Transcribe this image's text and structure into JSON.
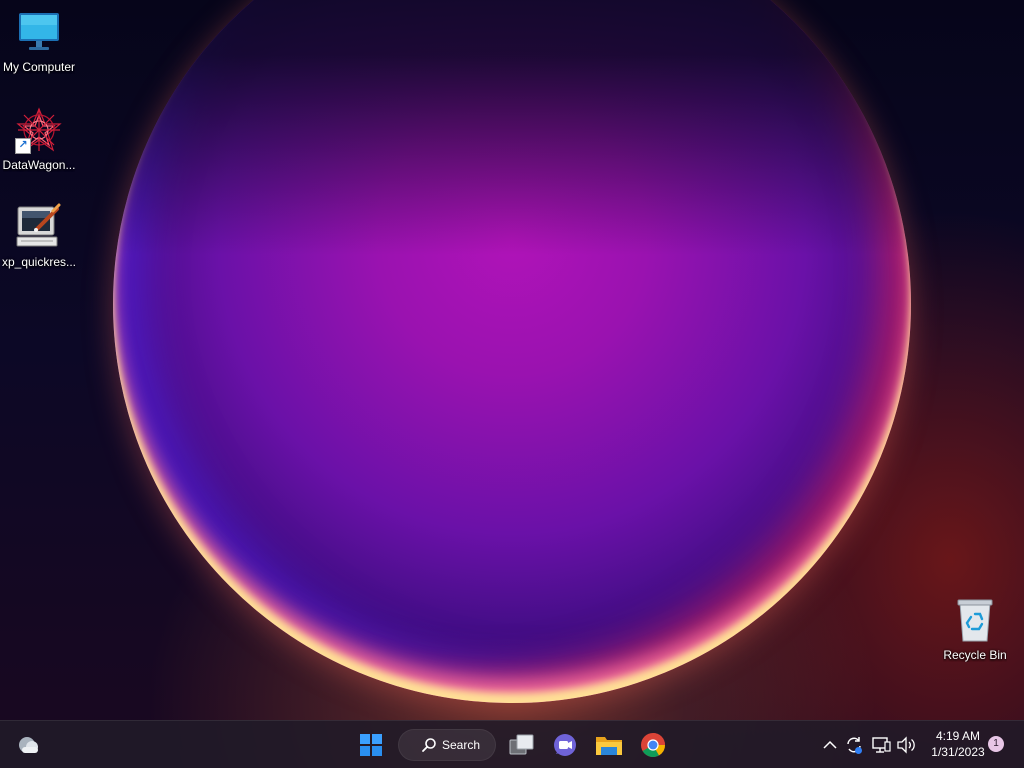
{
  "desktop": {
    "icons": [
      {
        "label": "My Computer",
        "icon": "monitor-icon"
      },
      {
        "label": "DataWagon...",
        "icon": "datawagon-icon"
      },
      {
        "label": "xp_quickres...",
        "icon": "quickres-icon"
      },
      {
        "label": "Recycle Bin",
        "icon": "recycle-bin-icon"
      }
    ]
  },
  "taskbar": {
    "widgets_icon": "weather-cloud-icon",
    "start_icon": "windows-start-icon",
    "search": {
      "label": "Search",
      "icon": "search-icon"
    },
    "pinned": [
      {
        "icon": "task-view-icon"
      },
      {
        "icon": "teams-chat-icon"
      },
      {
        "icon": "file-explorer-icon"
      },
      {
        "icon": "chrome-icon"
      }
    ],
    "tray": {
      "icons": [
        "chevron-up-icon",
        "sync-icon",
        "network-icon",
        "volume-icon"
      ],
      "time": "4:19 AM",
      "date": "1/31/2023",
      "notification_count": "1"
    }
  },
  "colors": {
    "taskbar_bg": "#201a28",
    "start_blue": "#3ba0ff",
    "chrome_red": "#db4437",
    "chrome_yellow": "#f4b400",
    "chrome_green": "#0f9d58",
    "chrome_blue": "#4285f4"
  }
}
